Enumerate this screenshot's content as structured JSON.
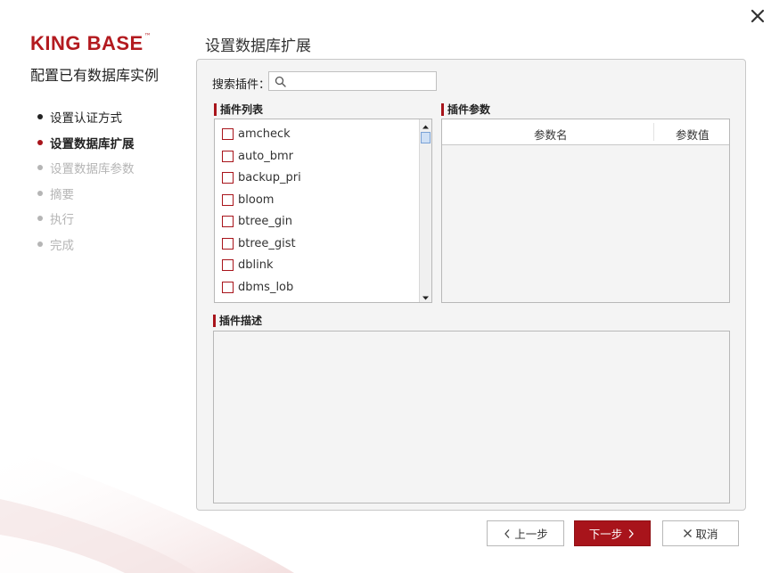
{
  "window": {
    "close_icon": "close-icon"
  },
  "brand": {
    "logo_text": "KING BASE",
    "logo_tm": "™",
    "color": "#b31a1f"
  },
  "sidebar": {
    "title": "配置已有数据库实例",
    "steps": [
      {
        "label": "设置认证方式",
        "state": "done"
      },
      {
        "label": "设置数据库扩展",
        "state": "active"
      },
      {
        "label": "设置数据库参数",
        "state": "pending"
      },
      {
        "label": "摘要",
        "state": "pending"
      },
      {
        "label": "执行",
        "state": "pending"
      },
      {
        "label": "完成",
        "state": "pending"
      }
    ]
  },
  "main": {
    "title": "设置数据库扩展",
    "search": {
      "label": "搜索插件：",
      "value": "",
      "placeholder": ""
    },
    "plugin_list": {
      "label": "插件列表",
      "items": [
        "amcheck",
        "auto_bmr",
        "backup_pri",
        "bloom",
        "btree_gin",
        "btree_gist",
        "dblink",
        "dbms_lob"
      ]
    },
    "plugin_params": {
      "label": "插件参数",
      "columns": [
        "参数名",
        "参数值"
      ]
    },
    "plugin_desc": {
      "label": "插件描述",
      "text": ""
    }
  },
  "footer": {
    "prev_label": "上一步",
    "next_label": "下一步",
    "cancel_label": "取消"
  },
  "colors": {
    "accent": "#a8141b",
    "disabled": "#b5b5b5"
  }
}
